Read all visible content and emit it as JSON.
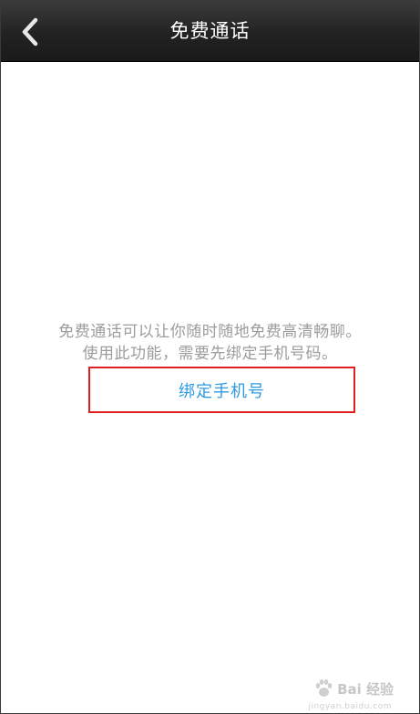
{
  "header": {
    "title": "免费通话",
    "back_icon": "chevron-left-icon"
  },
  "main": {
    "description_line1": "免费通话可以让你随时随地免费高清畅聊。",
    "description_line2": "使用此功能，需要先绑定手机号码。",
    "bind_button_label": "绑定手机号"
  },
  "watermark": {
    "text": "Bai 经验",
    "sub": "jingyan.baidu.com"
  },
  "colors": {
    "topbar": "#222222",
    "description": "#9c9c9c",
    "link": "#2f9ae0",
    "highlight_box": "#e02020"
  }
}
